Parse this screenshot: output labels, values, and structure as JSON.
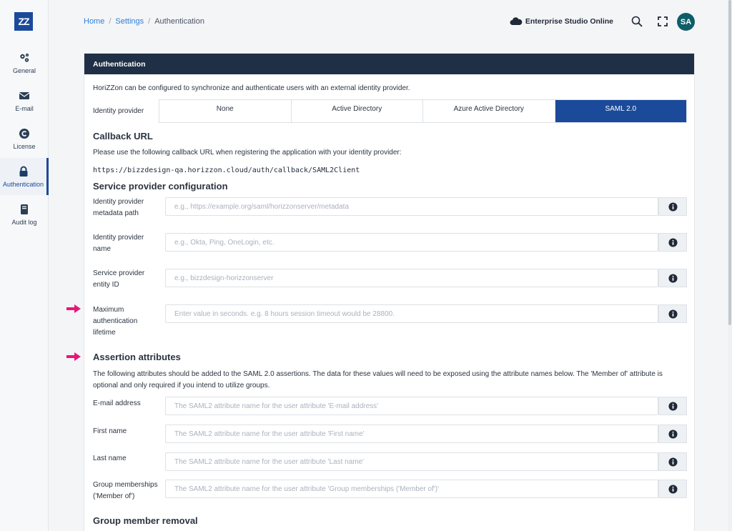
{
  "sidebar": {
    "logo_text": "ZZ",
    "items": [
      {
        "label": "General",
        "icon": "gears-icon"
      },
      {
        "label": "E-mail",
        "icon": "envelope-icon"
      },
      {
        "label": "License",
        "icon": "copyright-icon"
      },
      {
        "label": "Authentication",
        "icon": "lock-icon"
      },
      {
        "label": "Audit log",
        "icon": "book-icon"
      }
    ]
  },
  "breadcrumb": {
    "home": "Home",
    "settings": "Settings",
    "current": "Authentication",
    "separator": "/"
  },
  "header": {
    "environment": "Enterprise Studio Online",
    "avatar_initials": "SA"
  },
  "card": {
    "title": "Authentication",
    "intro": "HoriZZon can be configured to synchronize and authenticate users with an external identity provider.",
    "idp_label": "Identity provider",
    "idp_options": [
      "None",
      "Active Directory",
      "Azure Active Directory",
      "SAML 2.0"
    ],
    "idp_selected": "SAML 2.0",
    "callback": {
      "title": "Callback URL",
      "text": "Please use the following callback URL when registering the application with your identity provider:",
      "url": "https://bizzdesign-qa.horizzon.cloud/auth/callback/SAML2Client"
    },
    "sp_config": {
      "title": "Service provider configuration",
      "fields": [
        {
          "label": "Identity provider metadata path",
          "placeholder": "e.g., https://example.org/saml/horizzonserver/metadata",
          "value": ""
        },
        {
          "label": "Identity provider name",
          "placeholder": "e.g., Okta, Ping, OneLogin, etc.",
          "value": ""
        },
        {
          "label": "Service provider entity ID",
          "placeholder": "e.g., bizzdesign-horizzonserver",
          "value": ""
        },
        {
          "label": "Maximum authentication lifetime",
          "placeholder": "Enter value in seconds. e.g. 8 hours session timeout would be 28800.",
          "value": ""
        }
      ]
    },
    "assertion": {
      "title": "Assertion attributes",
      "text": "The following attributes should be added to the SAML 2.0 assertions. The data for these values will need to be exposed using the attribute names below. The 'Member of' attribute is optional and only required if you intend to utilize groups.",
      "fields": [
        {
          "label": "E-mail address",
          "placeholder": "The SAML2 attribute name for the user attribute 'E-mail address'",
          "value": ""
        },
        {
          "label": "First name",
          "placeholder": "The SAML2 attribute name for the user attribute 'First name'",
          "value": ""
        },
        {
          "label": "Last name",
          "placeholder": "The SAML2 attribute name for the user attribute 'Last name'",
          "value": ""
        },
        {
          "label": "Group memberships ('Member of')",
          "placeholder": "The SAML2 attribute name for the user attribute 'Group memberships ('Member of')'",
          "value": ""
        }
      ]
    },
    "group_removal": {
      "title": "Group member removal"
    }
  },
  "colors": {
    "accent": "#1b4a9b",
    "header_bg": "#1f2f45",
    "arrow": "#e5177b",
    "avatar": "#0f5d68"
  }
}
